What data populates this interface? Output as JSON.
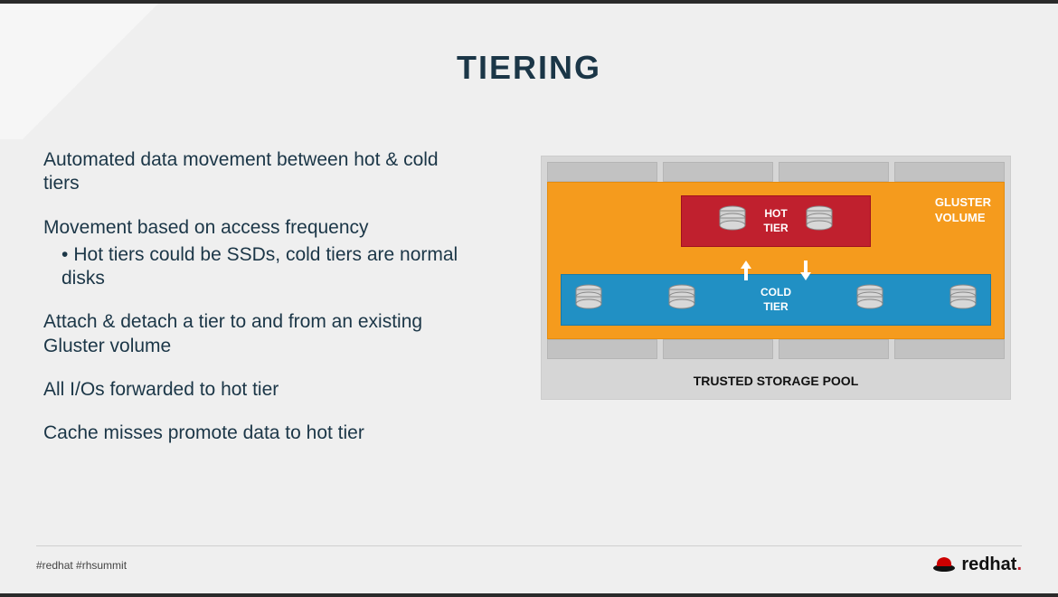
{
  "title": "TIERING",
  "bullets": [
    {
      "text": "Automated data movement between hot & cold tiers"
    },
    {
      "text": "Movement based on access frequency",
      "sub": "Hot tiers could be SSDs, cold tiers are normal disks"
    },
    {
      "text": "Attach & detach a tier to and from an existing Gluster volume"
    },
    {
      "text": "All I/Os forwarded to hot tier"
    },
    {
      "text": "Cache misses promote data to hot tier"
    }
  ],
  "diagram": {
    "volume_label_line1": "GLUSTER",
    "volume_label_line2": "VOLUME",
    "hot_label_line1": "HOT",
    "hot_label_line2": "TIER",
    "cold_label_line1": "COLD",
    "cold_label_line2": "TIER",
    "pool_label": "TRUSTED STORAGE POOL"
  },
  "footer": {
    "hashtags": "#redhat  #rhsummit",
    "logo_text": "redhat"
  }
}
